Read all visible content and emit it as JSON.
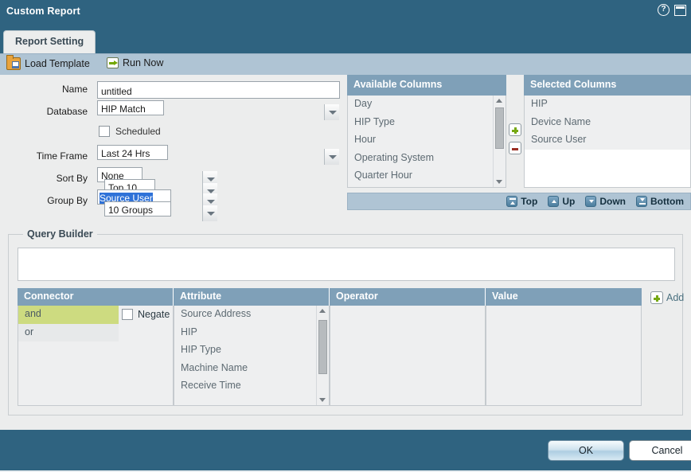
{
  "window": {
    "title": "Custom Report",
    "help_icon": "help-circle-icon",
    "restore_icon": "restore-window-icon"
  },
  "tabs": [
    {
      "label": "Report Setting",
      "active": true
    }
  ],
  "toolbar": {
    "load_template": "Load Template",
    "load_template_icon": "folder-report-icon",
    "run_now": "Run Now",
    "run_now_icon": "green-arrow-icon"
  },
  "form": {
    "name": {
      "label": "Name",
      "value": "untitled"
    },
    "database": {
      "label": "Database",
      "value": "HIP Match"
    },
    "scheduled": {
      "label": "Scheduled",
      "checked": false
    },
    "time_frame": {
      "label": "Time Frame",
      "value": "Last 24 Hrs"
    },
    "sort_by": {
      "label": "Sort By",
      "value": "None",
      "limit": "Top 10"
    },
    "group_by": {
      "label": "Group By",
      "value": "Source User",
      "count": "10 Groups",
      "selected": true
    }
  },
  "available_columns": {
    "header": "Available Columns",
    "items": [
      "Day",
      "HIP Type",
      "Hour",
      "Operating System",
      "Quarter Hour"
    ]
  },
  "selected_columns": {
    "header": "Selected Columns",
    "items": [
      "HIP",
      "Device Name",
      "Source User"
    ]
  },
  "transfer": {
    "add_icon": "plus-icon",
    "remove_icon": "minus-icon"
  },
  "order_bar": [
    {
      "label": "Top",
      "icon": "move-top-icon"
    },
    {
      "label": "Up",
      "icon": "move-up-icon"
    },
    {
      "label": "Down",
      "icon": "move-down-icon"
    },
    {
      "label": "Bottom",
      "icon": "move-bottom-icon"
    }
  ],
  "query_builder": {
    "legend": "Query Builder",
    "expression": "",
    "columns": {
      "connector": "Connector",
      "attribute": "Attribute",
      "operator": "Operator",
      "value": "Value"
    },
    "connectors": [
      "and",
      "or"
    ],
    "connector_selected": "and",
    "negate": {
      "label": "Negate",
      "checked": false
    },
    "attributes": [
      "Source Address",
      "HIP",
      "HIP Type",
      "Machine Name",
      "Receive Time"
    ],
    "operators": [],
    "values": [],
    "add_label": "Add",
    "add_icon": "plus-icon"
  },
  "footer": {
    "ok": "OK",
    "cancel": "Cancel"
  },
  "colors": {
    "header_bg": "#2f6380",
    "toolbar_bg": "#afc4d4",
    "panel_bg": "#eceded",
    "list_header_bg": "#7fa0b8",
    "selection_blue": "#2f72d8",
    "connector_highlight": "#cddb80"
  }
}
